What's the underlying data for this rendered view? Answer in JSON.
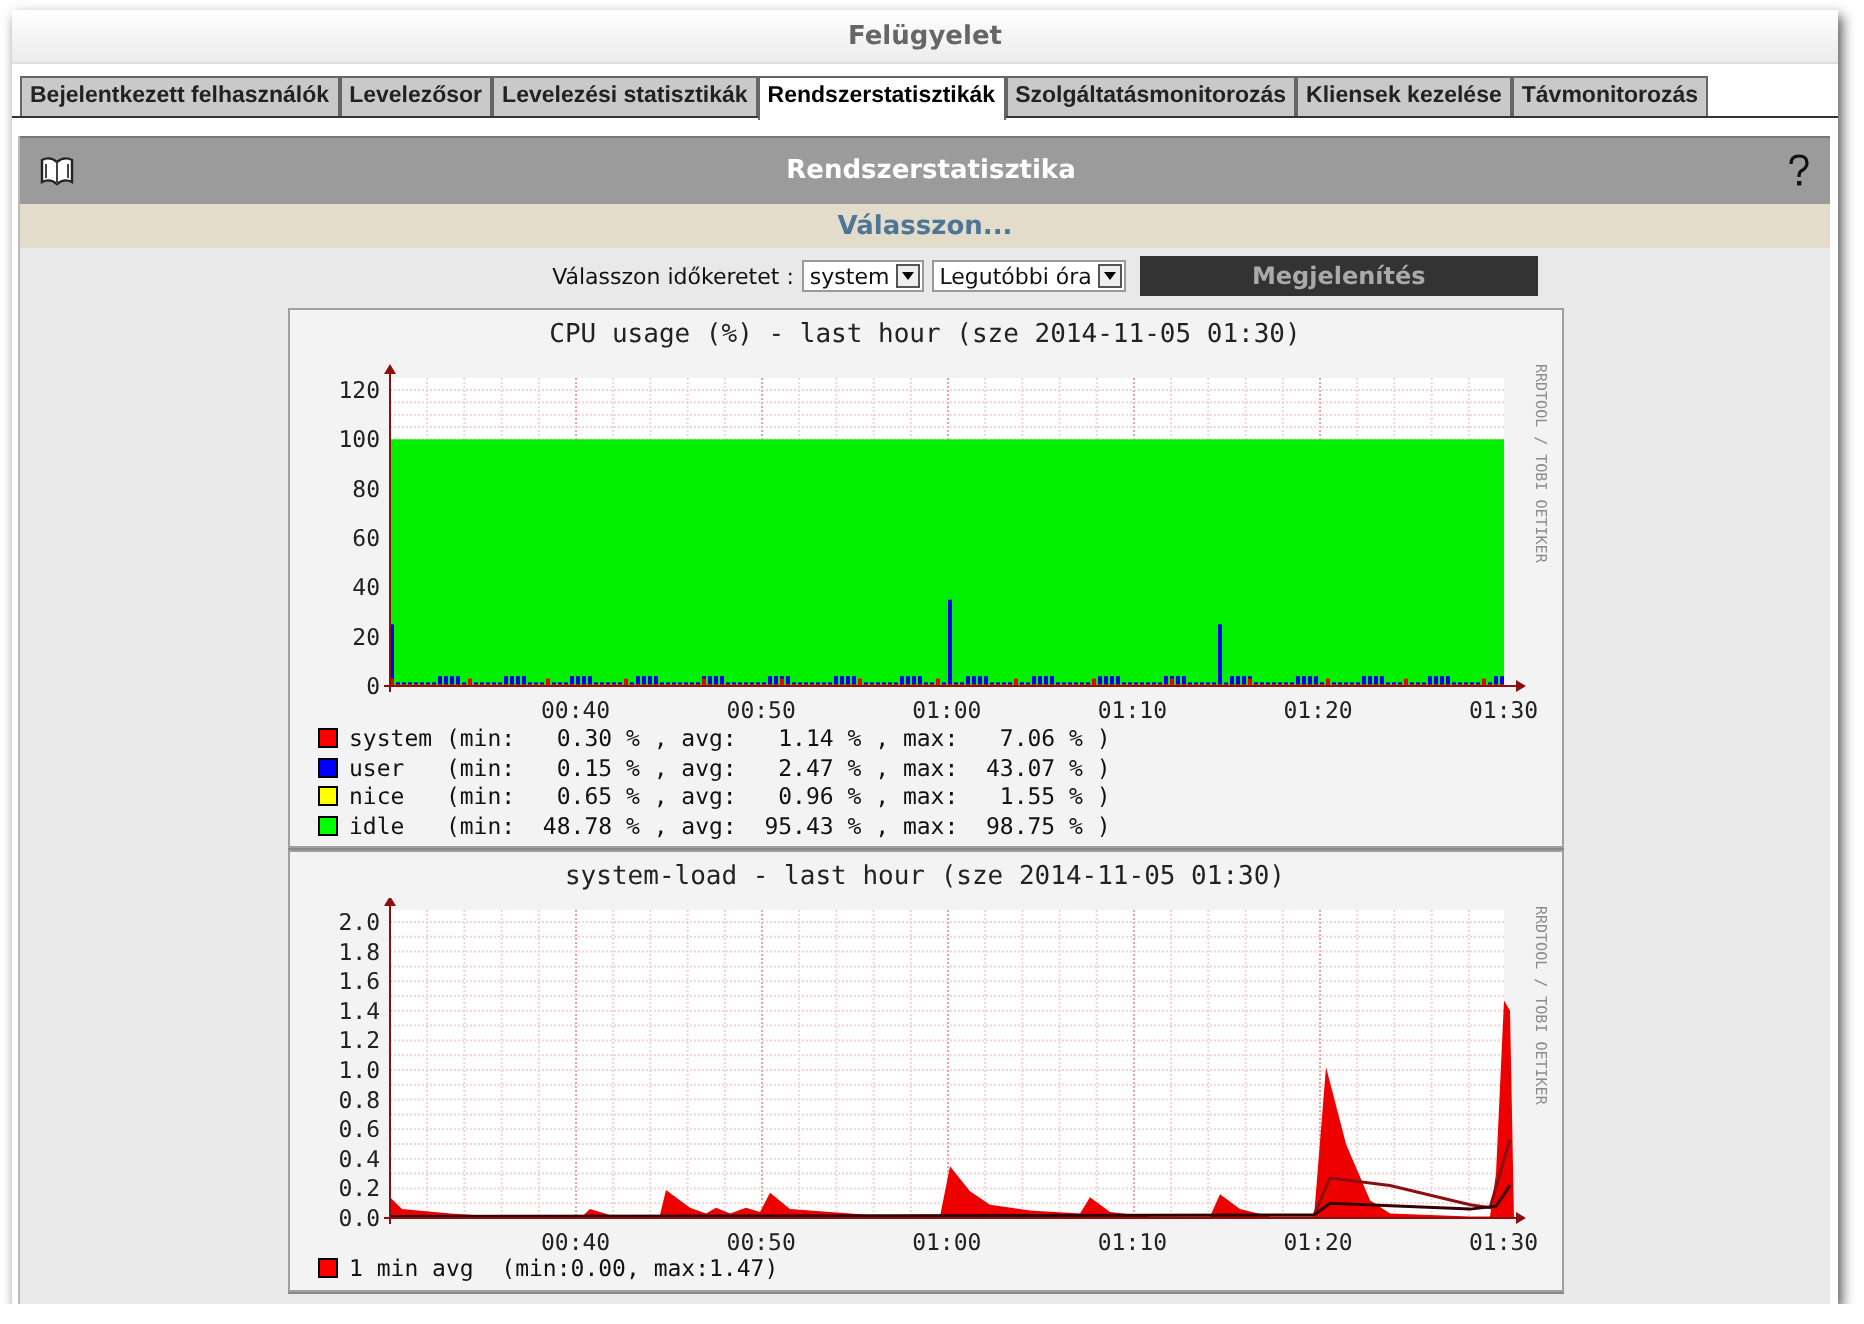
{
  "window": {
    "title": "Felügyelet"
  },
  "tabs": [
    {
      "label": "Bejelentkezett felhasználók",
      "selected": false
    },
    {
      "label": "Levelezősor",
      "selected": false
    },
    {
      "label": "Levelezési statisztikák",
      "selected": false
    },
    {
      "label": "Rendszerstatisztikák",
      "selected": true
    },
    {
      "label": "Szolgáltatásmonitorozás",
      "selected": false
    },
    {
      "label": "Kliensek kezelése",
      "selected": false
    },
    {
      "label": "Távmonitorozás",
      "selected": false
    }
  ],
  "panel": {
    "title": "Rendszerstatisztika",
    "subtitle": "Válasszon...",
    "filter": {
      "label": "Válasszon időkeretet :",
      "selects": [
        {
          "value": "system"
        },
        {
          "value": "Legutóbbi óra"
        }
      ],
      "button": "Megjelenítés"
    },
    "graphs": [
      {
        "kind": "cpu",
        "title": "CPU usage (%) - last hour (sze 2014-11-05 01:30)",
        "y_labels": [
          "120",
          "100",
          "80",
          "60",
          "40",
          "20",
          "0"
        ],
        "x_labels": [
          "00:40",
          "00:50",
          "01:00",
          "01:10",
          "01:20",
          "01:30"
        ],
        "side_text": "RRDTOOL / TOBI OETIKER",
        "legend": [
          {
            "color": "#ff0000",
            "text": "system (min:   0.30 % , avg:   1.14 % , max:   7.06 % )"
          },
          {
            "color": "#0000ff",
            "text": "user   (min:   0.15 % , avg:   2.47 % , max:  43.07 % )"
          },
          {
            "color": "#ffff00",
            "text": "nice   (min:   0.65 % , avg:   0.96 % , max:   1.55 % )"
          },
          {
            "color": "#00ff00",
            "text": "idle   (min:  48.78 % , avg:  95.43 % , max:  98.75 % )"
          }
        ]
      },
      {
        "kind": "load",
        "title": "system-load - last hour (sze 2014-11-05 01:30)",
        "y_labels": [
          "2.0",
          "1.8",
          "1.6",
          "1.4",
          "1.2",
          "1.0",
          "0.8",
          "0.6",
          "0.4",
          "0.2",
          "0.0"
        ],
        "x_labels": [
          "00:40",
          "00:50",
          "01:00",
          "01:10",
          "01:20",
          "01:30"
        ],
        "side_text": "RRDTOOL / TOBI OETIKER",
        "legend": [
          {
            "color": "#ff0000",
            "text": "1 min avg  (min:0.00, max:1.47)"
          }
        ]
      }
    ]
  }
}
